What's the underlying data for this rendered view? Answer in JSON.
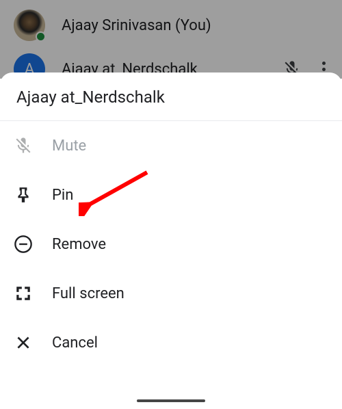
{
  "participants": [
    {
      "name": "Ajaay Srinivasan (You)"
    },
    {
      "name": "Ajaay at_Nerdschalk",
      "initial": "A"
    }
  ],
  "sheet": {
    "title": "Ajaay at_Nerdschalk",
    "items": [
      {
        "label": "Mute",
        "disabled": true
      },
      {
        "label": "Pin"
      },
      {
        "label": "Remove"
      },
      {
        "label": "Full screen"
      },
      {
        "label": "Cancel"
      }
    ]
  }
}
